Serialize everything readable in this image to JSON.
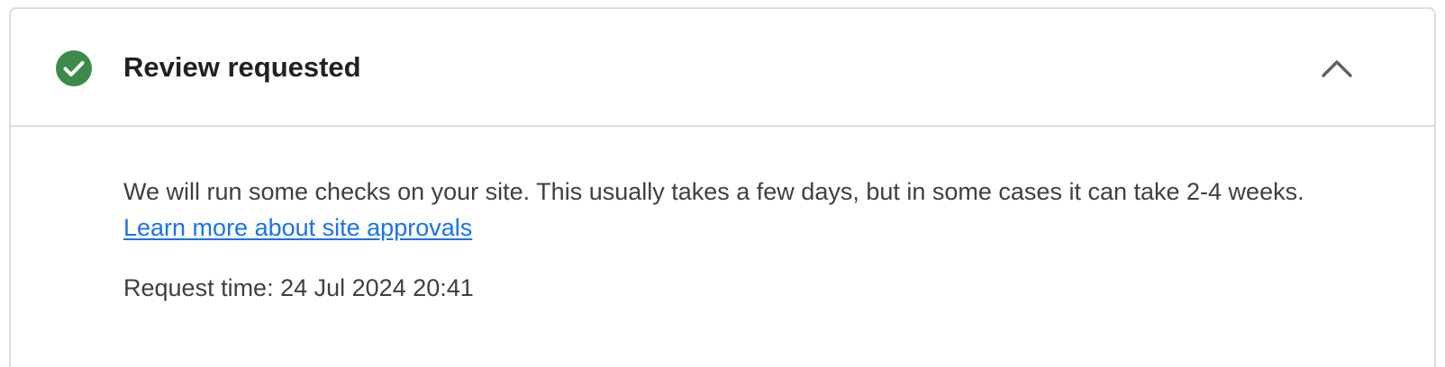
{
  "status": {
    "icon": "check-circle-icon",
    "color": "#34a853",
    "title": "Review requested"
  },
  "toggle": {
    "icon": "chevron-up-icon"
  },
  "details": {
    "description": "We will run some checks on your site. This usually takes a few days, but in some cases it can take 2-4 weeks.",
    "link_text": "Learn more about site approvals",
    "request_time_label": "Request time:",
    "request_time_value": "24 Jul 2024 20:41"
  },
  "colors": {
    "link": "#1a73e8",
    "border": "#dadce0",
    "success": "#34a853"
  }
}
